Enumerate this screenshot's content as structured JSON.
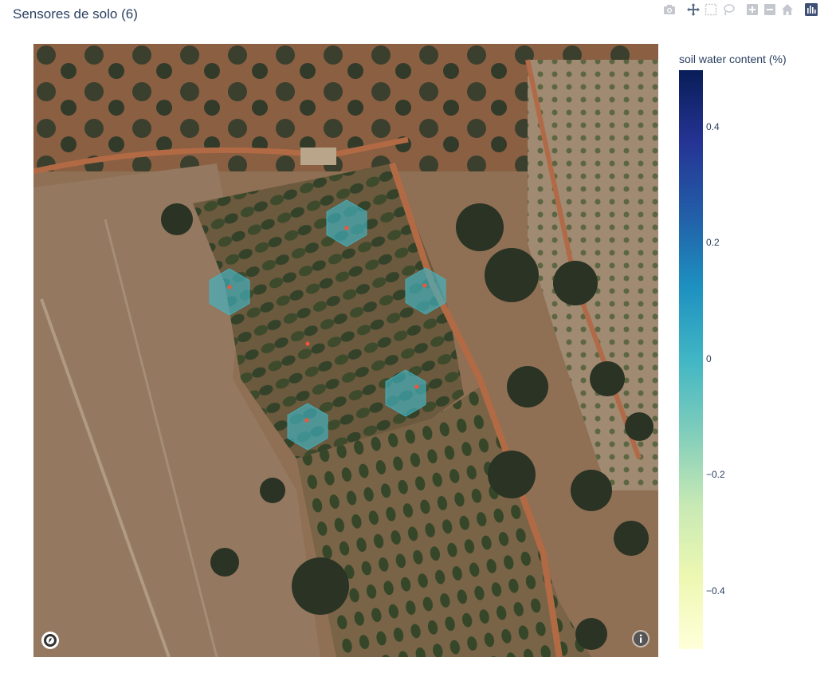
{
  "title": "Sensores de solo (6)",
  "modebar": [
    {
      "name": "camera-icon",
      "label": "Download plot as a png"
    },
    {
      "name": "pan-icon",
      "label": "Pan"
    },
    {
      "name": "box-select-icon",
      "label": "Box Select"
    },
    {
      "name": "lasso-select-icon",
      "label": "Lasso Select"
    },
    {
      "name": "zoom-in-icon",
      "label": "Zoom in"
    },
    {
      "name": "zoom-out-icon",
      "label": "Zoom out"
    },
    {
      "name": "reset-view-icon",
      "label": "Reset view"
    },
    {
      "name": "plotly-logo-icon",
      "label": "Produced with Plotly"
    }
  ],
  "map": {
    "basemap": "satellite",
    "controls": [
      {
        "name": "mapbox-logo-icon"
      },
      {
        "name": "info-icon"
      }
    ]
  },
  "colorbar": {
    "title": "soil water content (%)",
    "range": [
      -0.5,
      0.5
    ],
    "ticks": [
      "0.4",
      "0.2",
      "0",
      "−0.2",
      "−0.4"
    ],
    "tick_values": [
      0.4,
      0.2,
      0,
      -0.2,
      -0.4
    ],
    "colorscale": [
      "#081d58",
      "#253494",
      "#225ea8",
      "#1d91c0",
      "#41b6c4",
      "#7fcdbb",
      "#c7e9b4",
      "#edf8b1",
      "#ffffd9"
    ]
  },
  "sensors": {
    "count": 6,
    "hexagon_fill": "#41b6c4",
    "point_color": "#ef553b"
  }
}
